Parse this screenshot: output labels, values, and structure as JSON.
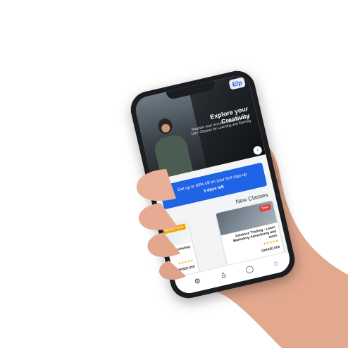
{
  "app": {
    "logo": "Elp",
    "hero_title": "Explore your Creativity",
    "hero_subtitle": "Register your account today & receive 100+ Classes for Learning and Earning"
  },
  "promo": {
    "line1": "Get up to 60% off on your first sign up",
    "line2": "3 days left"
  },
  "section_title": "New Classes",
  "cards": [
    {
      "title": "Advance Trading - Learn Marketing Advertising and more",
      "tag": "New",
      "tag_color": "#e53935",
      "stars": "★★★★★",
      "price": "IDR420.000"
    },
    {
      "title": "Photography Workshop",
      "tag": "Highest Rank",
      "tag_color": "#f4a300",
      "stars": "★★★★★",
      "price": "IDR320.000"
    }
  ],
  "tabs": [
    {
      "name": "home-icon",
      "glyph": "⌂"
    },
    {
      "name": "chat-icon",
      "glyph": "◯"
    },
    {
      "name": "profile-icon",
      "glyph": "♙"
    },
    {
      "name": "settings-icon",
      "glyph": "⚙"
    }
  ],
  "colors": {
    "accent": "#1f63e6",
    "tag_new": "#e53935",
    "tag_rank": "#f4a300"
  }
}
